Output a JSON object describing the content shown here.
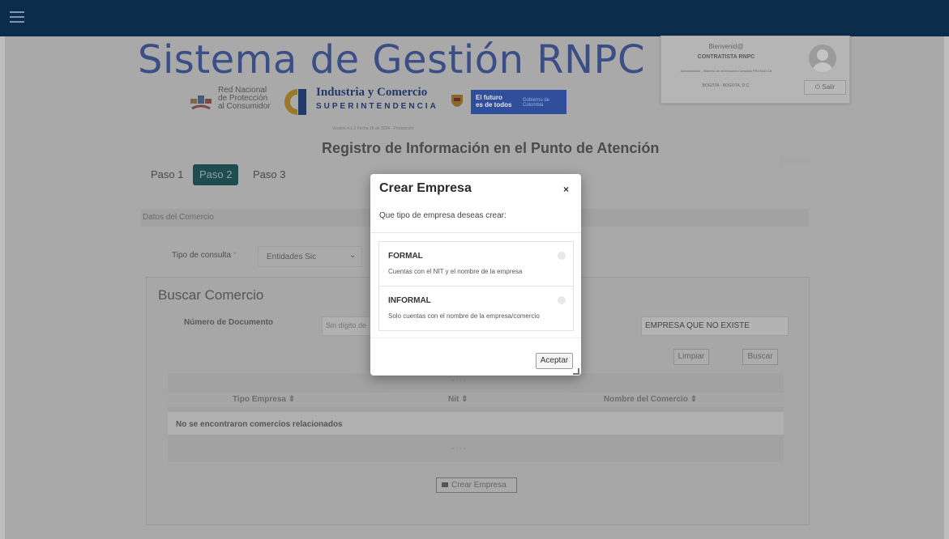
{
  "app": {
    "title": "Sistema de Gestión RNPC",
    "version": "Versión 4.1.2 Fecha 16 de 2024 - Producción"
  },
  "logos": {
    "red": {
      "line1": "Red Nacional",
      "line2": "de Protección",
      "line3": "al Consumidor"
    },
    "sic": {
      "line1": "Industria y Comercio",
      "line2": "SUPERINTENDENCIA"
    },
    "gov": {
      "line1": "El futuro",
      "line2": "es de todos",
      "line3": "Gobierno de Colombia"
    }
  },
  "user": {
    "welcome": "Bienvenid@",
    "role": "CONTRATISTA RNPC",
    "detail": "Administrador - Sistema de Información Consejos PROSAD CA",
    "location": "BOGOTA - BOGOTA, D.C.",
    "logout_label": "Salir"
  },
  "page": {
    "subtitle": "Registro de Información en el Punto de Atención",
    "tabs": [
      {
        "label": "Paso 1",
        "active": false
      },
      {
        "label": "Paso 2",
        "active": true
      },
      {
        "label": "Paso 3",
        "active": false
      }
    ],
    "section_title": "Datos del Comercio",
    "tipo_consulta_label": "Tipo de consulta",
    "tipo_consulta_required": "*",
    "tipo_consulta_value": "Entidades Sic"
  },
  "search": {
    "title": "Buscar Comercio",
    "numdoc_label": "Número de Documento",
    "numdoc_placeholder": "Sin dígito de",
    "empresa_value": "EMPRESA QUE NO EXISTE",
    "clear_label": "Limpiar",
    "search_label": "Buscar",
    "pager": "«  ‹  ›  »",
    "columns": [
      "Tipo Empresa ⇕",
      "Nit ⇕",
      "Nombre del Comercio ⇕"
    ],
    "empty_message": "No se encontraron comercios relacionados",
    "create_label": "Crear Empresa"
  },
  "modal": {
    "title": "Crear Empresa",
    "close": "×",
    "question": "Que tipo de empresa deseas crear:",
    "options": [
      {
        "name": "FORMAL",
        "desc": "Cuentas con el NIT y el nombre de la empresa"
      },
      {
        "name": "INFORMAL",
        "desc": "Solo cuentas con el nombre de la empresa/comercio"
      }
    ],
    "accept_label": "Aceptar"
  },
  "colors": {
    "topbar": "#0b2c4a",
    "title": "#3b4f86",
    "tab_active": "#1f4c4e",
    "overlay": "#a9a9a9"
  }
}
